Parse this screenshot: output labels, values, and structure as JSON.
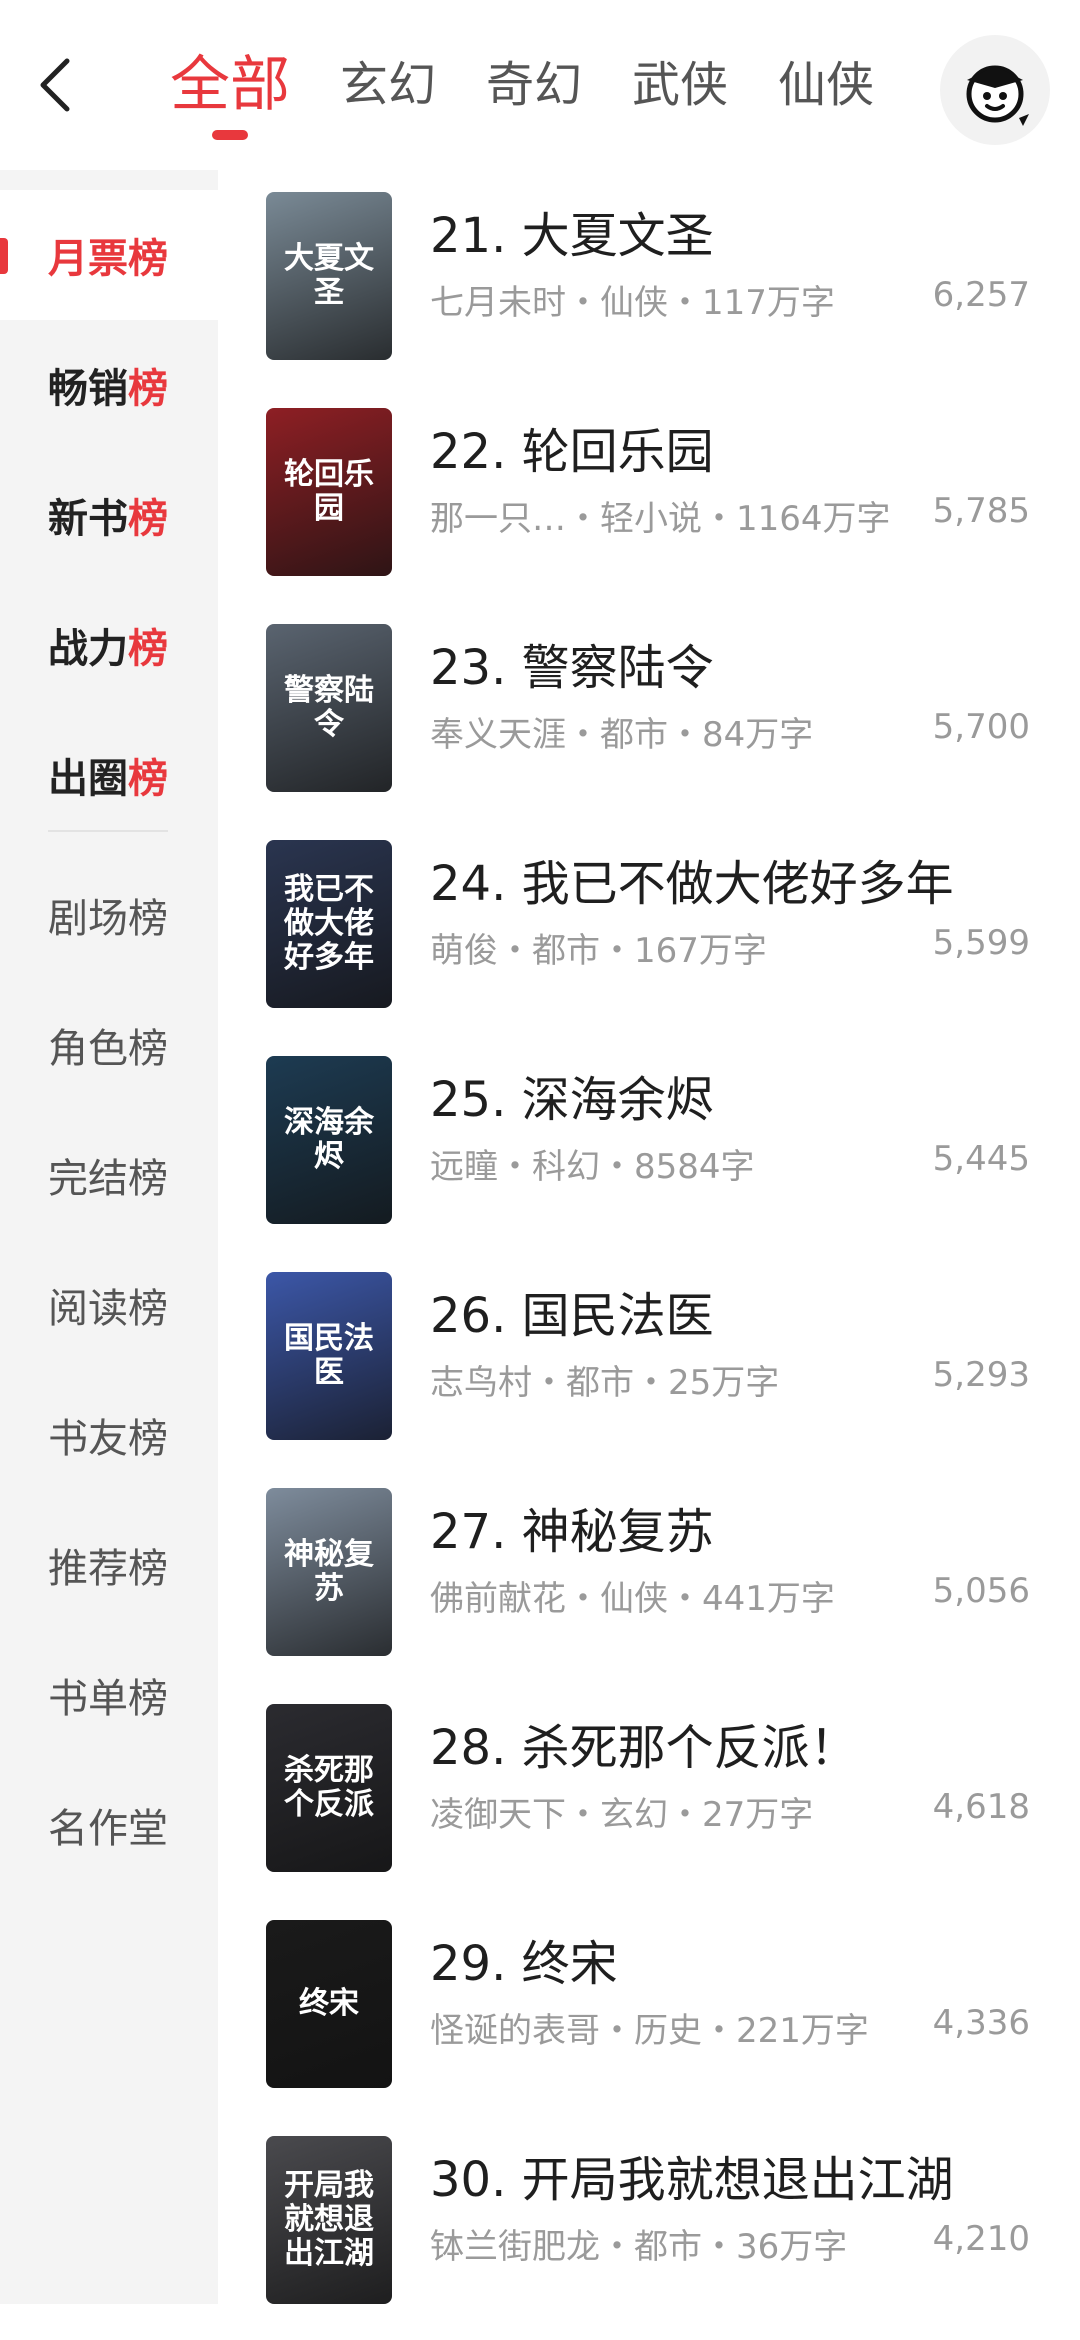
{
  "header": {
    "tabs": [
      "全部",
      "玄幻",
      "奇幻",
      "武侠",
      "仙侠"
    ],
    "active_tab": 0
  },
  "sidebar": {
    "primary": [
      {
        "prefix": "月票",
        "suffix": "榜"
      },
      {
        "prefix": "畅销",
        "suffix": "榜"
      },
      {
        "prefix": "新书",
        "suffix": "榜"
      },
      {
        "prefix": "战力",
        "suffix": "榜"
      },
      {
        "prefix": "出圈",
        "suffix": "榜"
      }
    ],
    "secondary": [
      "剧场榜",
      "角色榜",
      "完结榜",
      "阅读榜",
      "书友榜",
      "推荐榜",
      "书单榜",
      "名作堂"
    ]
  },
  "books": [
    {
      "title": "21. 大夏文圣",
      "meta": "七月未时・仙侠・117万字",
      "count": "6,257",
      "cover_text": "大夏文圣",
      "cover_color": "#7a8a96"
    },
    {
      "title": "22. 轮回乐园",
      "meta": "那一只…・轻小说・1164万字",
      "count": "5,785",
      "cover_text": "轮回乐园",
      "cover_color": "#8e1f24"
    },
    {
      "title": "23. 警察陆令",
      "meta": "奉义天涯・都市・84万字",
      "count": "5,700",
      "cover_text": "警察陆令",
      "cover_color": "#5a6470"
    },
    {
      "title": "24. 我已不做大佬好多年",
      "meta": "萌俊・都市・167万字",
      "count": "5,599",
      "cover_text": "我已不做大佬好多年",
      "cover_color": "#2a3550"
    },
    {
      "title": "25. 深海余烬",
      "meta": "远瞳・科幻・8584字",
      "count": "5,445",
      "cover_text": "深海余烬",
      "cover_color": "#1d3b52"
    },
    {
      "title": "26. 国民法医",
      "meta": "志鸟村・都市・25万字",
      "count": "5,293",
      "cover_text": "国民法医",
      "cover_color": "#3c57a8"
    },
    {
      "title": "27. 神秘复苏",
      "meta": "佛前献花・仙侠・441万字",
      "count": "5,056",
      "cover_text": "神秘复苏",
      "cover_color": "#7e8c9c"
    },
    {
      "title": "28. 杀死那个反派！",
      "meta": "凌御天下・玄幻・27万字",
      "count": "4,618",
      "cover_text": "杀死那个反派",
      "cover_color": "#2b2b30"
    },
    {
      "title": "29. 终宋",
      "meta": "怪诞的表哥・历史・221万字",
      "count": "4,336",
      "cover_text": "终宋",
      "cover_color": "#1a1a1a"
    },
    {
      "title": "30. 开局我就想退出江湖",
      "meta": "钵兰街肥龙・都市・36万字",
      "count": "4,210",
      "cover_text": "开局我就想退出江湖",
      "cover_color": "#4a4a4e"
    }
  ],
  "colors": {
    "accent": "#e8383d",
    "sidebar_bg": "#f4f4f4",
    "meta_text": "#9a9a9a"
  },
  "icons": {
    "back": "chevron-left-icon",
    "avatar": "user-avatar-icon"
  }
}
